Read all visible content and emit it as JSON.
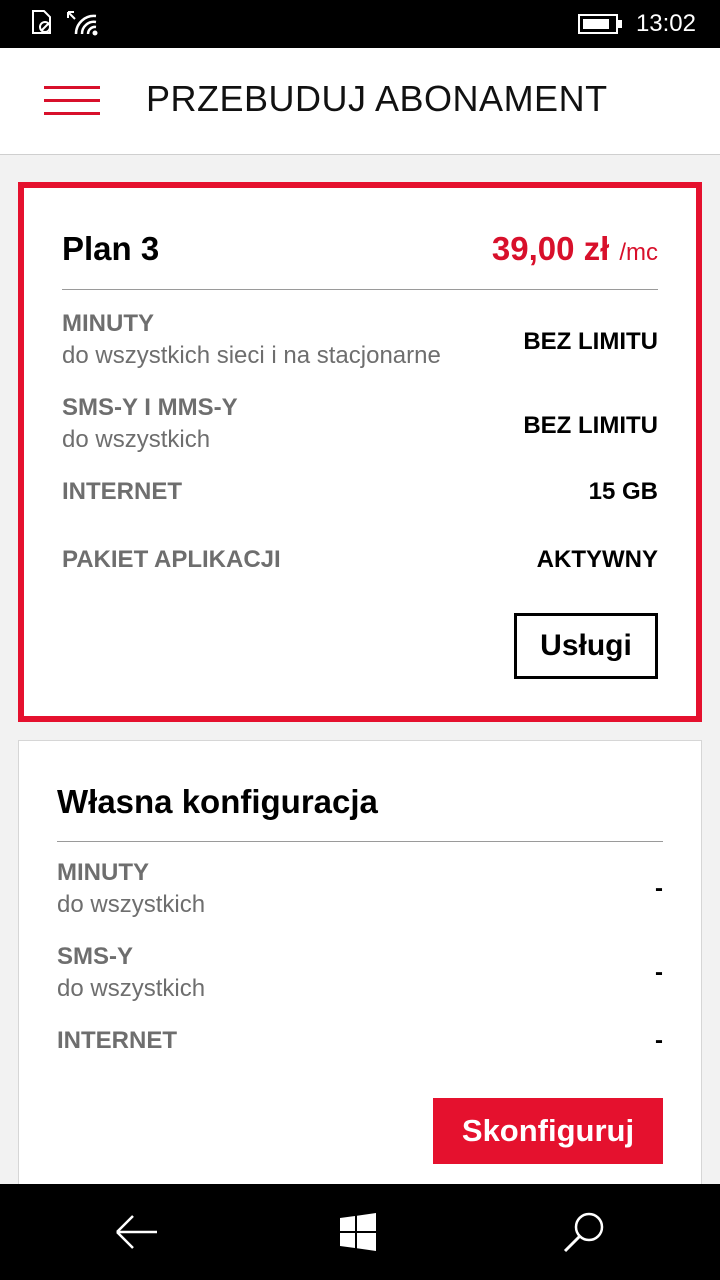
{
  "status_bar": {
    "time": "13:02",
    "battery_level": 0.85,
    "icons": [
      "no-sim-icon",
      "wifi-icon",
      "battery-icon"
    ]
  },
  "header": {
    "title": "PRZEBUDUJ ABONAMENT",
    "menu_icon": "hamburger-menu-icon"
  },
  "plan": {
    "title": "Plan 3",
    "price": "39,00 zł",
    "price_unit": "/mc",
    "features": [
      {
        "name": "MINUTY",
        "description": "do wszystkich sieci i na stacjonarne",
        "value": "BEZ LIMITU"
      },
      {
        "name": "SMS-Y I MMS-Y",
        "description": "do wszystkich",
        "value": "BEZ LIMITU"
      },
      {
        "name": "INTERNET",
        "description": "",
        "value": "15 GB"
      },
      {
        "name": "PAKIET APLIKACJI",
        "description": "",
        "value": "AKTYWNY"
      }
    ],
    "button_label": "Usługi"
  },
  "custom": {
    "title": "Własna konfiguracja",
    "features": [
      {
        "name": "MINUTY",
        "description": "do wszystkich",
        "value": "-"
      },
      {
        "name": "SMS-Y",
        "description": "do wszystkich",
        "value": "-"
      },
      {
        "name": "INTERNET",
        "description": "",
        "value": "-"
      }
    ],
    "button_label": "Skonfiguruj"
  },
  "nav": {
    "icons": [
      "back-arrow-icon",
      "windows-start-icon",
      "search-icon"
    ]
  },
  "colors": {
    "accent": "#e5112e",
    "text_muted": "#6e6e6e"
  }
}
